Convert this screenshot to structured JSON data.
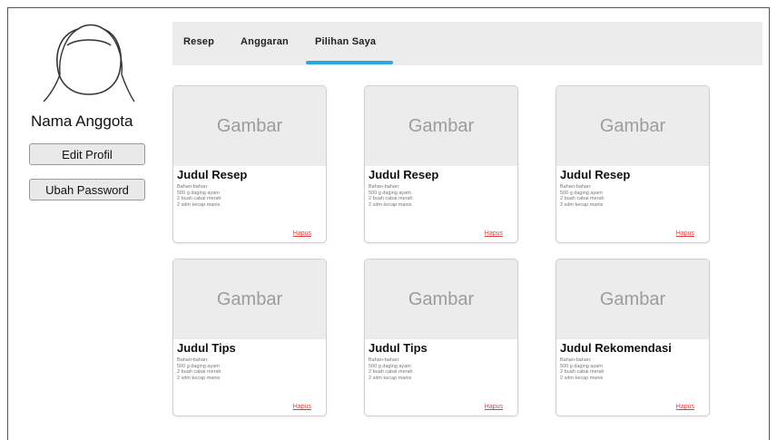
{
  "profile": {
    "name": "Nama Anggota",
    "edit_label": "Edit Profil",
    "password_label": "Ubah Password",
    "avatar_icon": "user-silhouette-icon"
  },
  "tabs": [
    {
      "label": "Resep"
    },
    {
      "label": "Anggaran"
    },
    {
      "label": "Pilihan Saya",
      "active": true
    }
  ],
  "colors": {
    "tab_active": "#2ea6e0",
    "link": "#e03a3a",
    "image_placeholder": "#ececec"
  },
  "cards": [
    {
      "image_label": "Gambar",
      "title": "Judul Resep",
      "lines": [
        "Bahan-bahan:",
        "500 g daging ayam",
        "2 buah cabai merah",
        "2 sdm kecap manis"
      ],
      "link": "Hapus"
    },
    {
      "image_label": "Gambar",
      "title": "Judul Resep",
      "lines": [
        "Bahan-bahan:",
        "500 g daging ayam",
        "2 buah cabai merah",
        "2 sdm kecap manis"
      ],
      "link": "Hapus"
    },
    {
      "image_label": "Gambar",
      "title": "Judul Resep",
      "lines": [
        "Bahan-bahan:",
        "500 g daging ayam",
        "2 buah cabai merah",
        "2 sdm kecap manis"
      ],
      "link": "Hapus"
    },
    {
      "image_label": "Gambar",
      "title": "Judul Tips",
      "lines": [
        "Bahan-bahan:",
        "500 g daging ayam",
        "2 buah cabai merah",
        "2 sdm kecap manis"
      ],
      "link": "Hapus"
    },
    {
      "image_label": "Gambar",
      "title": "Judul Tips",
      "lines": [
        "Bahan-bahan:",
        "500 g daging ayam",
        "2 buah cabai merah",
        "2 sdm kecap manis"
      ],
      "link": "Hapus"
    },
    {
      "image_label": "Gambar",
      "title": "Judul Rekomendasi",
      "lines": [
        "Bahan-bahan:",
        "500 g daging ayam",
        "2 buah cabai merah",
        "2 sdm kecap manis"
      ],
      "link": "Hapus"
    }
  ]
}
